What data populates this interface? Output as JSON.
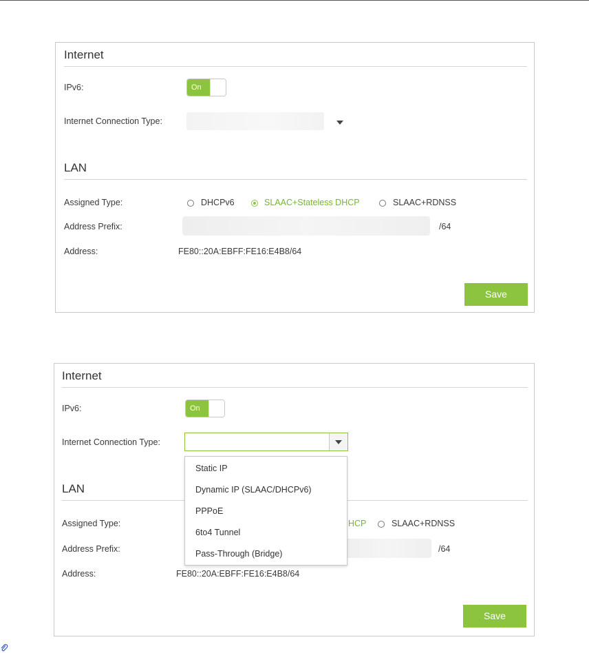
{
  "screenshots": [
    {
      "internet": {
        "title": "Internet",
        "ipv6_label": "IPv6:",
        "ipv6_toggle_text": "On",
        "connection_type_label": "Internet Connection Type:",
        "connection_type_value": ""
      },
      "lan": {
        "title": "LAN",
        "assigned_type_label": "Assigned Type:",
        "options": [
          "DHCPv6",
          "SLAAC+Stateless DHCP",
          "SLAAC+RDNSS"
        ],
        "selected_option": "SLAAC+Stateless DHCP",
        "address_prefix_label": "Address Prefix:",
        "address_prefix_suffix": "/64",
        "address_label": "Address:",
        "address_value": "FE80::20A:EBFF:FE16:E4B8/64"
      },
      "save_label": "Save"
    },
    {
      "internet": {
        "title": "Internet",
        "ipv6_label": "IPv6:",
        "ipv6_toggle_text": "On",
        "connection_type_label": "Internet Connection Type:",
        "connection_type_value": "",
        "dropdown_open": true,
        "dropdown_options": [
          "Static IP",
          "Dynamic IP (SLAAC/DHCPv6)",
          "PPPoE",
          "6to4 Tunnel",
          "Pass-Through (Bridge)"
        ]
      },
      "lan": {
        "title": "LAN",
        "assigned_type_label": "Assigned Type:",
        "visible_option_fragment": "HCP",
        "options_visible": [
          "SLAAC+RDNSS"
        ],
        "address_prefix_label": "Address Prefix:",
        "address_prefix_suffix": "/64",
        "address_label": "Address:",
        "address_value": "FE80::20A:EBFF:FE16:E4B8/64"
      },
      "save_label": "Save"
    }
  ],
  "colors": {
    "accent": "#8dc43f",
    "accent_text": "#7ab52c",
    "border": "#c9c9c9",
    "text": "#333333"
  },
  "icons": {
    "toggle": "switch-on-icon",
    "dropdown": "triangle-down-icon",
    "footnote": "paperclip-icon"
  }
}
